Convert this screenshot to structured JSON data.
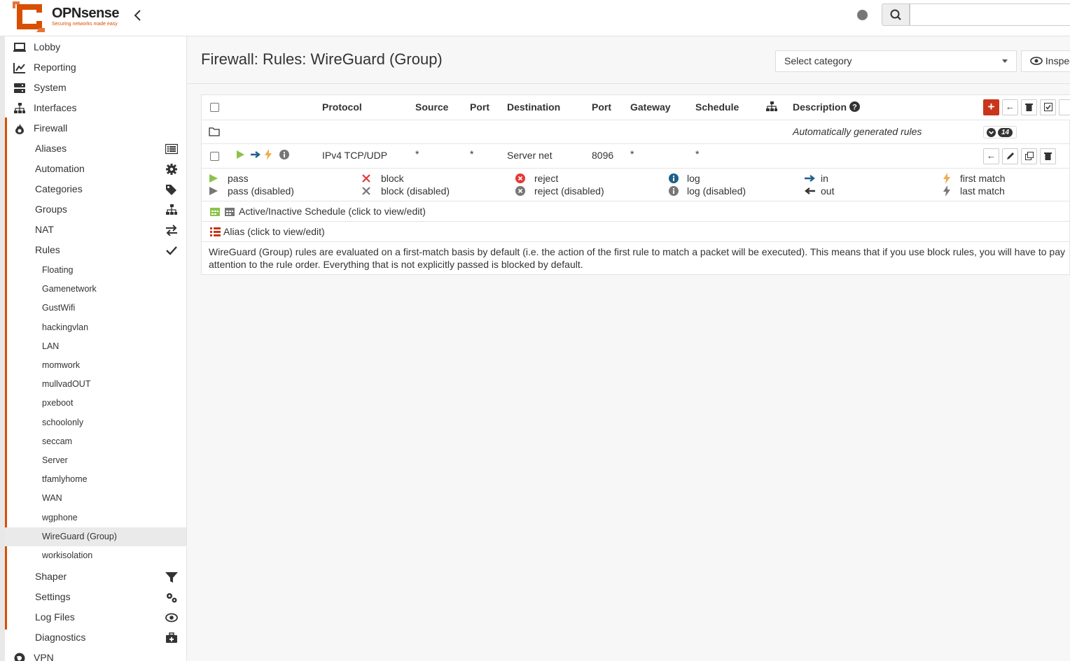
{
  "brand": {
    "name": "OPNsense",
    "tagline": "Securing networks made easy",
    "color": "#d94f00"
  },
  "page_title": "Firewall: Rules: WireGuard (Group)",
  "category_select": {
    "placeholder": "Select category"
  },
  "inspect_button": {
    "label": "Inspect"
  },
  "nav": {
    "top": [
      {
        "label": "Lobby",
        "icon": "laptop-icon"
      },
      {
        "label": "Reporting",
        "icon": "chart-icon"
      },
      {
        "label": "System",
        "icon": "server-icon"
      },
      {
        "label": "Interfaces",
        "icon": "sitemap-icon"
      },
      {
        "label": "Firewall",
        "icon": "fire-icon"
      }
    ],
    "firewall": [
      {
        "label": "Aliases",
        "icon": "list-icon"
      },
      {
        "label": "Automation",
        "icon": "gear-icon"
      },
      {
        "label": "Categories",
        "icon": "tags-icon"
      },
      {
        "label": "Groups",
        "icon": "sitemap-icon"
      },
      {
        "label": "NAT",
        "icon": "exchange-icon"
      },
      {
        "label": "Rules",
        "icon": "check-icon"
      }
    ],
    "rules": [
      "Floating",
      "Gamenetwork",
      "GustWifi",
      "hackingvlan",
      "LAN",
      "momwork",
      "mullvadOUT",
      "pxeboot",
      "schoolonly",
      "seccam",
      "Server",
      "tfamlyhome",
      "WAN",
      "wgphone",
      "WireGuard (Group)",
      "workisolation"
    ],
    "rules_active": "WireGuard (Group)",
    "firewall_after": [
      {
        "label": "Shaper",
        "icon": "filter-icon"
      },
      {
        "label": "Settings",
        "icon": "gears-icon"
      },
      {
        "label": "Log Files",
        "icon": "eye-icon"
      },
      {
        "label": "Diagnostics",
        "icon": "medkit-icon"
      }
    ],
    "bottom": [
      {
        "label": "VPN",
        "icon": "globe-icon"
      }
    ]
  },
  "table": {
    "headers": {
      "protocol": "Protocol",
      "source": "Source",
      "port": "Port",
      "destination": "Destination",
      "dport": "Port",
      "gateway": "Gateway",
      "schedule": "Schedule",
      "description": "Description"
    },
    "auto_row": {
      "description": "Automatically generated rules",
      "count": "14"
    },
    "rules": [
      {
        "protocol": "IPv4 TCP/UDP",
        "source": "*",
        "source_port": "*",
        "destination": "Server net",
        "dest_port": "8096",
        "gateway": "*",
        "schedule": "*",
        "description": ""
      }
    ]
  },
  "legend": {
    "pass": "pass",
    "pass_disabled": "pass (disabled)",
    "block": "block",
    "block_disabled": "block (disabled)",
    "reject": "reject",
    "reject_disabled": "reject (disabled)",
    "log": "log",
    "log_disabled": "log (disabled)",
    "in": "in",
    "out": "out",
    "first_match": "first match",
    "last_match": "last match"
  },
  "schedule_note": "Active/Inactive Schedule (click to view/edit)",
  "alias_note": "Alias (click to view/edit)",
  "info_text": "WireGuard (Group) rules are evaluated on a first-match basis by default (i.e. the action of the first rule to match a packet will be executed). This means that if you use block rules, you will have to pay attention to the rule order. Everything that is not explicitly passed is blocked by default.",
  "colors": {
    "pass": "#8bc34a",
    "block": "#e53935",
    "in": "#1f5f8b",
    "match": "#f0ad4e",
    "add": "#c9341a"
  }
}
